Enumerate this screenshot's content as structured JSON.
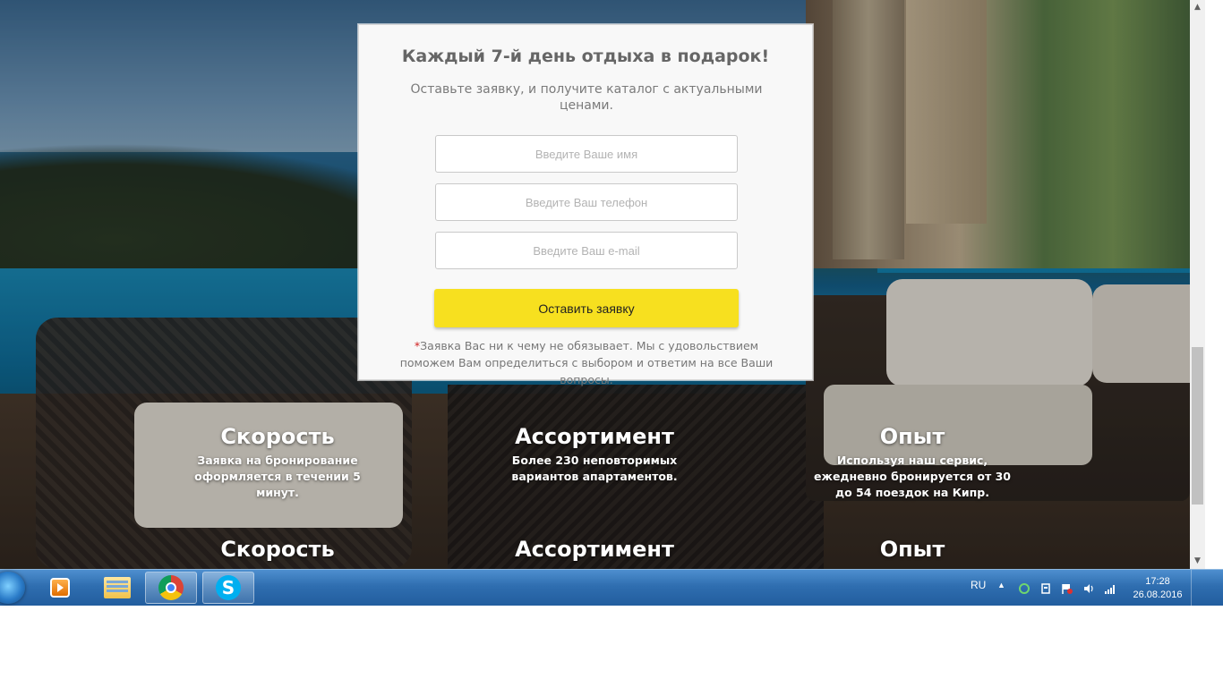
{
  "form": {
    "title": "Каждый 7-й день отдыха в подарок!",
    "subtitle": "Оставьте заявку, и получите каталог с актуальными ценами.",
    "name_placeholder": "Введите Ваше имя",
    "phone_placeholder": "Введите Ваш телефон",
    "email_placeholder": "Введите Ваш e-mail",
    "submit_label": "Оставить заявку",
    "note_star": "*",
    "note_text": "Заявка Вас ни к чему не обязывает. Мы с удовольствием поможем Вам определиться с выбором и ответим на все Ваши вопросы."
  },
  "features_row1": [
    {
      "title": "Скорость",
      "text": "Заявка на бронирование оформляется в течении 5 минут."
    },
    {
      "title": "Ассортимент",
      "text": "Более 230 неповторимых вариантов апартаментов."
    },
    {
      "title": "Опыт",
      "text": "Используя наш сервис, ежедневно бронируется от 30 до 54 поездок на Кипр."
    }
  ],
  "features_row2": [
    {
      "title": "Скорость"
    },
    {
      "title": "Ассортимент"
    },
    {
      "title": "Опыт"
    }
  ],
  "scrollbar": {
    "up_arrow": "▲",
    "down_arrow": "▼"
  },
  "taskbar": {
    "apps": [
      {
        "name": "Windows Media Player",
        "icon": "media-player-icon"
      },
      {
        "name": "Windows Explorer",
        "icon": "folder-icon"
      },
      {
        "name": "Google Chrome",
        "icon": "chrome-icon",
        "active": true
      },
      {
        "name": "Skype",
        "icon": "skype-icon",
        "glyph": "S"
      }
    ],
    "language": "RU",
    "tray_up": "▲",
    "time": "17:28",
    "date": "26.08.2016"
  },
  "colors": {
    "button": "#f7e01f",
    "taskbar": "#2f6eb0",
    "title": "#666666"
  }
}
